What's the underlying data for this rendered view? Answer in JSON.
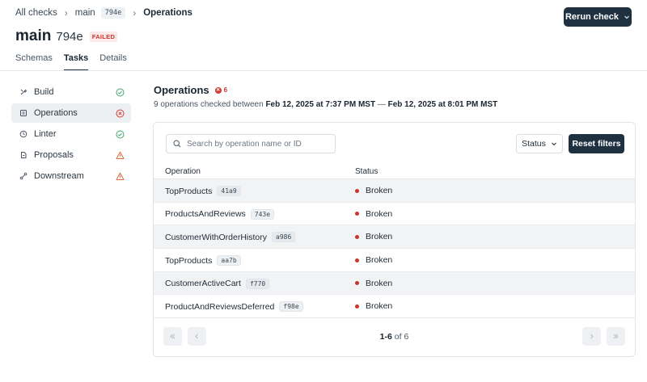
{
  "breadcrumb": {
    "root": "All checks",
    "branch": "main",
    "branch_id": "794e",
    "current": "Operations"
  },
  "header": {
    "title": "main",
    "subtitle": "794e",
    "status_badge": "FAILED",
    "rerun_label": "Rerun check"
  },
  "tabs": [
    {
      "label": "Schemas"
    },
    {
      "label": "Tasks"
    },
    {
      "label": "Details"
    }
  ],
  "sidebar": {
    "items": [
      {
        "label": "Build",
        "status": "passed"
      },
      {
        "label": "Operations",
        "status": "failed"
      },
      {
        "label": "Linter",
        "status": "passed"
      },
      {
        "label": "Proposals",
        "status": "warning"
      },
      {
        "label": "Downstream",
        "status": "warning"
      }
    ]
  },
  "main": {
    "title": "Operations",
    "error_count": "6",
    "summary_prefix": "9 operations checked between",
    "summary_start": "Feb 12, 2025 at 7:37 PM MST",
    "summary_sep": "—",
    "summary_end": "Feb 12, 2025 at 8:01 PM MST"
  },
  "filters": {
    "search_placeholder": "Search by operation name or ID",
    "status_label": "Status",
    "reset_label": "Reset filters"
  },
  "table": {
    "columns": [
      "Operation",
      "Status"
    ],
    "rows": [
      {
        "name": "TopProducts",
        "id": "41a9",
        "status": "Broken"
      },
      {
        "name": "ProductsAndReviews",
        "id": "743e",
        "status": "Broken"
      },
      {
        "name": "CustomerWithOrderHistory",
        "id": "a986",
        "status": "Broken"
      },
      {
        "name": "TopProducts",
        "id": "aa7b",
        "status": "Broken"
      },
      {
        "name": "CustomerActiveCart",
        "id": "f770",
        "status": "Broken"
      },
      {
        "name": "ProductAndReviewsDeferred",
        "id": "f98e",
        "status": "Broken"
      }
    ]
  },
  "pagination": {
    "range": "1-6",
    "of_label": "of",
    "total": "6"
  },
  "colors": {
    "primary": "#1f3140",
    "danger": "#c8342f",
    "success": "#3ea66b",
    "warning": "#e2683c"
  }
}
